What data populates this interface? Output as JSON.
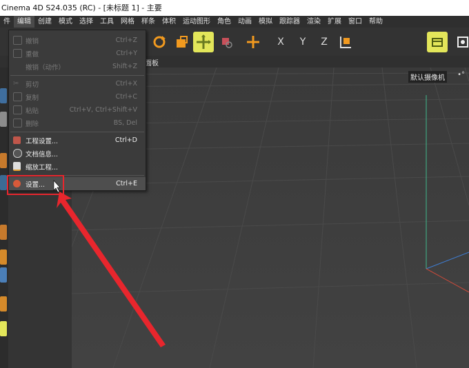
{
  "window": {
    "title": "Cinema 4D S24.035 (RC) - [未标题 1] - 主要"
  },
  "menubar": {
    "items": [
      "件",
      "编辑",
      "创建",
      "模式",
      "选择",
      "工具",
      "网格",
      "样条",
      "体积",
      "运动图形",
      "角色",
      "动画",
      "模拟",
      "跟踪器",
      "渲染",
      "扩展",
      "窗口",
      "帮助"
    ],
    "active_index": 1
  },
  "toolbar": {
    "axis_x": "X",
    "axis_y": "Y",
    "axis_z": "Z"
  },
  "subbar": {
    "label": "面板"
  },
  "viewport": {
    "camera_label": "默认摄像机",
    "camera_icons": "•°"
  },
  "edit_menu": {
    "items": [
      {
        "label": "撤销",
        "shortcut": "Ctrl+Z",
        "enabled": false
      },
      {
        "label": "重做",
        "shortcut": "Ctrl+Y",
        "enabled": false
      },
      {
        "label": "撤销（动作）",
        "shortcut": "Shift+Z",
        "enabled": false
      },
      {
        "label": "剪切",
        "shortcut": "Ctrl+X",
        "enabled": false
      },
      {
        "label": "复制",
        "shortcut": "Ctrl+C",
        "enabled": false
      },
      {
        "label": "粘贴",
        "shortcut": "Ctrl+V, Ctrl+Shift+V",
        "enabled": false
      },
      {
        "label": "删除",
        "shortcut": "BS, Del",
        "enabled": false
      },
      {
        "label": "工程设置...",
        "shortcut": "Ctrl+D",
        "enabled": true
      },
      {
        "label": "文档信息...",
        "shortcut": "",
        "enabled": true
      },
      {
        "label": "缩放工程...",
        "shortcut": "",
        "enabled": true
      },
      {
        "label": "设置...",
        "shortcut": "Ctrl+E",
        "enabled": true,
        "highlighted": true
      }
    ]
  },
  "colors": {
    "annotation_red": "#e8262d",
    "accent_orange": "#f29a1f",
    "highlight_yellow": "#e3e65a"
  }
}
